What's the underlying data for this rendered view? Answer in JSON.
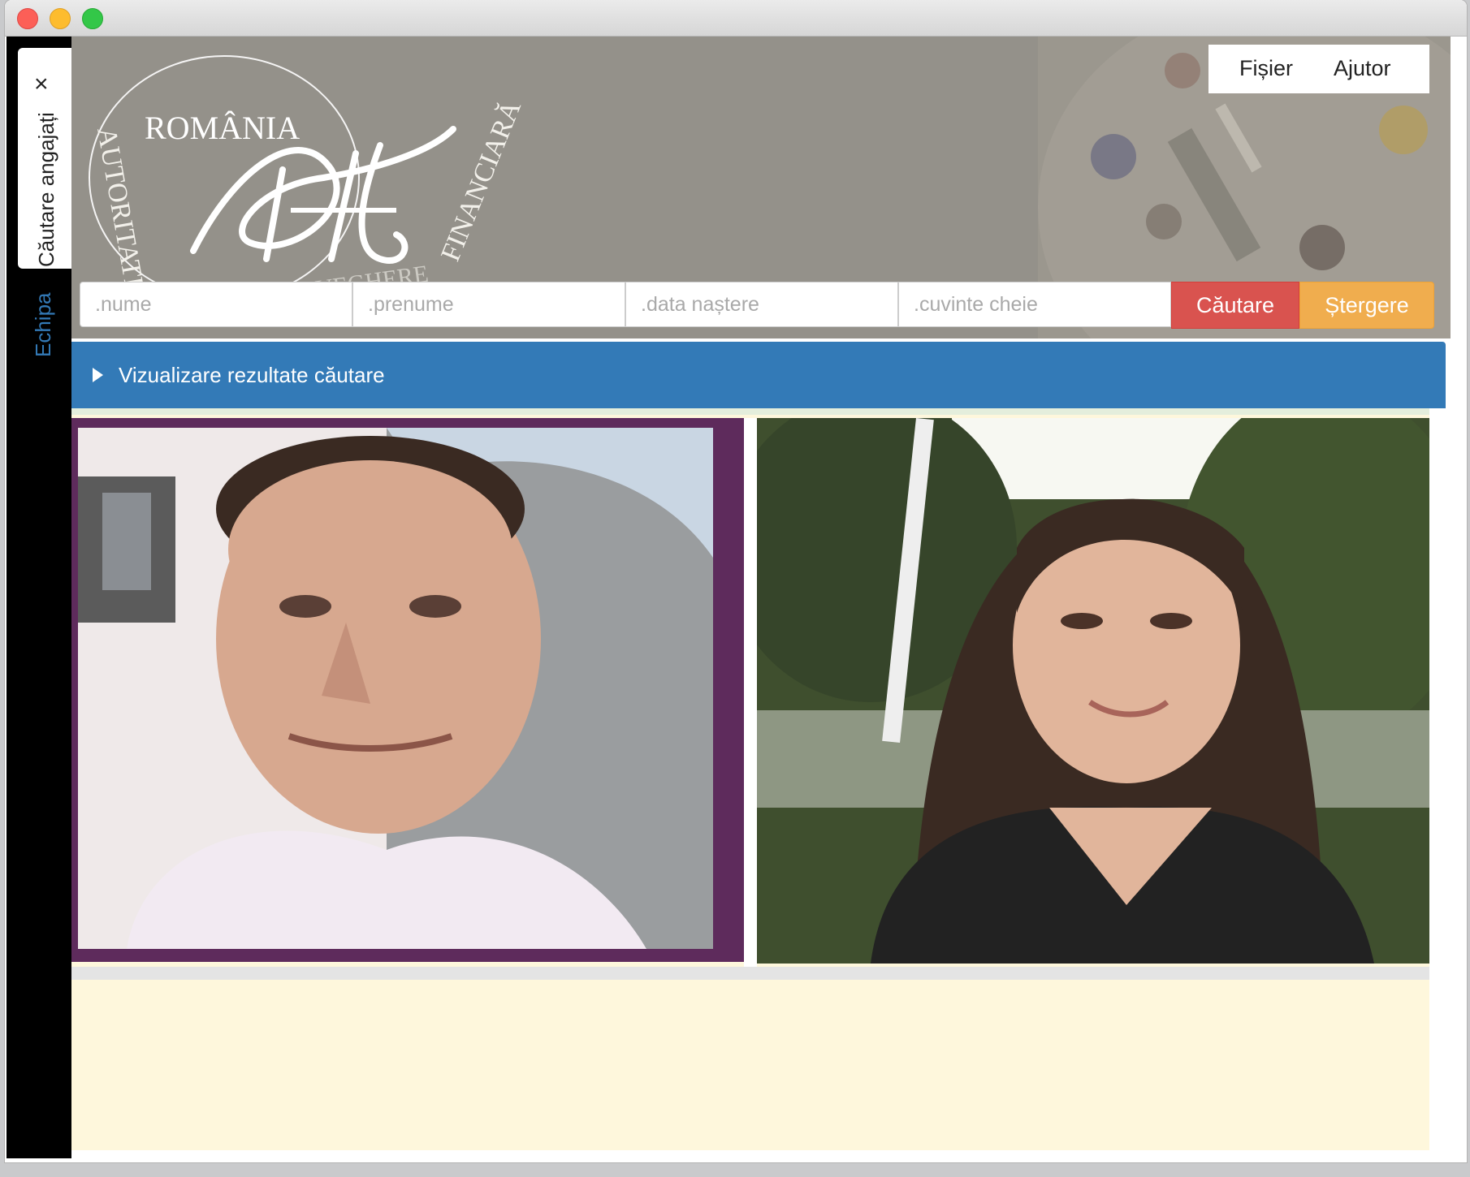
{
  "window": {
    "controls": [
      "close",
      "minimize",
      "zoom"
    ]
  },
  "sidebar": {
    "tabs": [
      {
        "label": "Căutare angajați",
        "active": true,
        "close_icon": "×"
      },
      {
        "label": "Echipa",
        "active": false
      }
    ]
  },
  "header": {
    "logo": {
      "top_text": "ROMÂNIA",
      "left_arc": "AUTORITATEA",
      "right_arc": "FINANCIARĂ",
      "bottom_arc": "SUPRAVEGHERE",
      "monogram": "ASF"
    },
    "menu": {
      "items": [
        "Fișier",
        "Ajutor"
      ]
    }
  },
  "search": {
    "nume_placeholder": ".nume",
    "prenume_placeholder": ".prenume",
    "data_placeholder": ".data naștere",
    "cuvinte_placeholder": ".cuvinte cheie",
    "search_button": "Căutare",
    "clear_button": "Ștergere"
  },
  "results": {
    "panel_title": "Vizualizare rezultate căutare",
    "expanded": false,
    "caret_icon": "caret-right-icon"
  },
  "colors": {
    "header_bg": "#94918a",
    "panel_blue": "#337ab7",
    "danger": "#d9534f",
    "warning": "#f0ad4e",
    "content_bg": "#fef7dc",
    "frame_purple": "#5e2b5c",
    "sidebar_bg": "#000000",
    "link_blue": "#337ab7"
  }
}
